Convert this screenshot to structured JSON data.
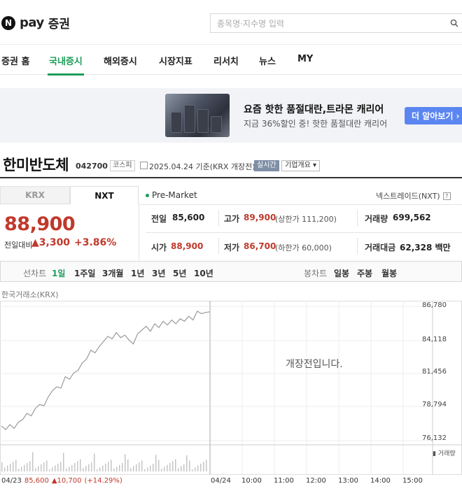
{
  "header": {
    "logo_pay": "pay",
    "logo_sec": "증권",
    "search_placeholder": "종목명·지수명 입력"
  },
  "gnb": {
    "items": [
      "증권 홈",
      "국내증시",
      "해외증시",
      "시장지표",
      "리서치",
      "뉴스",
      "MY"
    ],
    "active": "국내증시"
  },
  "banner": {
    "title": "요즘 핫한 품절대란,트라몬 캐리어",
    "subtitle": "지금 36%할인 중! 핫한 품절대란 캐리어",
    "button": "더 알아보기 ›"
  },
  "stock": {
    "name": "한미반도체",
    "code": "042700",
    "market": "코스피",
    "date": "2025.04.24 기준(KRX 개장전)",
    "realtime": "실시간",
    "company_info": "기업개요 ▾"
  },
  "tabs": [
    "KRX",
    "NXT"
  ],
  "premarket": "Pre-Market",
  "nextrade": "넥스트레이드(NXT)",
  "price": {
    "current": "88,900",
    "change_label": "전일대비",
    "change": "▲3,300",
    "change_pct": "+3.86%"
  },
  "quote": {
    "prev_label": "전일",
    "prev": "85,600",
    "high_label": "고가",
    "high": "89,900",
    "upper": "(상한가 111,200)",
    "volume_label": "거래량",
    "volume": "699,562",
    "open_label": "시가",
    "open": "88,900",
    "low_label": "저가",
    "low": "86,700",
    "lower": "(하한가 60,000)",
    "amount_label": "거래대금",
    "amount": "62,328 백만"
  },
  "period_bar": {
    "line_label": "선차트",
    "line_items": [
      "1일",
      "1주일",
      "3개월",
      "1년",
      "3년",
      "5년",
      "10년"
    ],
    "selected": "1일",
    "candle_label": "봉차트",
    "candle_items": [
      "일봉",
      "주봉",
      "월봉"
    ]
  },
  "chart_data": {
    "type": "line",
    "title": "한국거래소(KRX)",
    "y_ticks": [
      "86,780",
      "84,118",
      "81,456",
      "78,794",
      "76,132"
    ],
    "ylim": [
      76132,
      86780
    ],
    "x_ticks": [
      "04/24",
      "10:00",
      "11:00",
      "12:00",
      "13:00",
      "14:00",
      "15:00"
    ],
    "series": [
      {
        "values": [
          77300,
          77000,
          77400,
          77100,
          77600,
          77800,
          78300,
          78100,
          78700,
          79000,
          78900,
          79600,
          80100,
          80400,
          80300,
          81200,
          81000,
          81500,
          81700,
          82300,
          82600,
          83300,
          83100,
          83600,
          84000,
          84400,
          84200,
          84700,
          84300,
          84500,
          84100,
          83800,
          84600,
          84900,
          85200,
          84800,
          85400,
          85100,
          85600,
          85300,
          85700,
          85400,
          85800,
          85600,
          86000,
          85700,
          86400,
          86200,
          86300,
          86350
        ]
      }
    ],
    "pre_open_text": "개장전입니다.",
    "volume_label": "거래량",
    "footer": {
      "date": "04/23",
      "close": "85,600",
      "change": "▲10,700",
      "change_pct": "(+14.29%)"
    }
  },
  "colors": {
    "accent": "#1e9d5a",
    "up": "#c0392b",
    "button": "#5b86f1"
  }
}
